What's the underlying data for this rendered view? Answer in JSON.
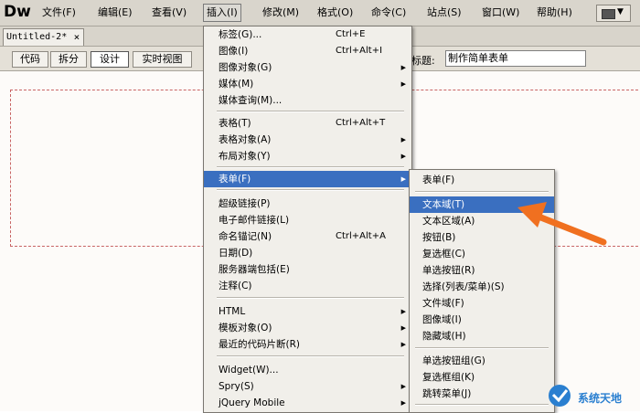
{
  "app": {
    "logo": "Dw"
  },
  "menubar": {
    "items": [
      {
        "label": "文件(F)"
      },
      {
        "label": "编辑(E)"
      },
      {
        "label": "查看(V)"
      },
      {
        "label": "插入(I)"
      },
      {
        "label": "修改(M)"
      },
      {
        "label": "格式(O)"
      },
      {
        "label": "命令(C)"
      },
      {
        "label": "站点(S)"
      },
      {
        "label": "窗口(W)"
      },
      {
        "label": "帮助(H)"
      }
    ]
  },
  "tabs": {
    "document": "Untitled-2*",
    "close": "×"
  },
  "toolbar": {
    "code": "代码",
    "split": "拆分",
    "design": "设计",
    "live_view": "实时视图",
    "title_label": "标题:",
    "title_value": "制作简单表单"
  },
  "insert_menu": {
    "items": [
      {
        "label": "标签(G)...",
        "shortcut": "Ctrl+E"
      },
      {
        "label": "图像(I)",
        "shortcut": "Ctrl+Alt+I"
      },
      {
        "label": "图像对象(G)",
        "submenu": true
      },
      {
        "label": "媒体(M)",
        "submenu": true
      },
      {
        "label": "媒体查询(M)..."
      },
      {
        "label": "表格(T)",
        "shortcut": "Ctrl+Alt+T"
      },
      {
        "label": "表格对象(A)",
        "submenu": true
      },
      {
        "label": "布局对象(Y)",
        "submenu": true
      },
      {
        "label": "表单(F)",
        "submenu": true,
        "highlighted": true
      },
      {
        "label": "超级链接(P)"
      },
      {
        "label": "电子邮件链接(L)"
      },
      {
        "label": "命名锚记(N)",
        "shortcut": "Ctrl+Alt+A"
      },
      {
        "label": "日期(D)"
      },
      {
        "label": "服务器端包括(E)"
      },
      {
        "label": "注释(C)"
      },
      {
        "label": "HTML",
        "submenu": true
      },
      {
        "label": "模板对象(O)",
        "submenu": true
      },
      {
        "label": "最近的代码片断(R)",
        "submenu": true
      },
      {
        "label": "Widget(W)..."
      },
      {
        "label": "Spry(S)",
        "submenu": true
      },
      {
        "label": "jQuery Mobile",
        "submenu": true
      }
    ]
  },
  "form_submenu": {
    "items": [
      {
        "label": "表单(F)"
      },
      {
        "label": "文本域(T)",
        "highlighted": true
      },
      {
        "label": "文本区域(A)"
      },
      {
        "label": "按钮(B)"
      },
      {
        "label": "复选框(C)"
      },
      {
        "label": "单选按钮(R)"
      },
      {
        "label": "选择(列表/菜单)(S)"
      },
      {
        "label": "文件域(F)"
      },
      {
        "label": "图像域(I)"
      },
      {
        "label": "隐藏域(H)"
      },
      {
        "label": "单选按钮组(G)"
      },
      {
        "label": "复选框组(K)"
      },
      {
        "label": "跳转菜单(J)"
      }
    ]
  },
  "watermark": {
    "text": "系统天地"
  },
  "colors": {
    "highlight": "#3a6fc0",
    "arrow": "#f07020",
    "form_outline": "#c86464"
  },
  "icons": {
    "submenu": "triangle-right-icon",
    "close": "close-icon",
    "layout": "layout-icon",
    "annotation": "orange-arrow-icon"
  }
}
